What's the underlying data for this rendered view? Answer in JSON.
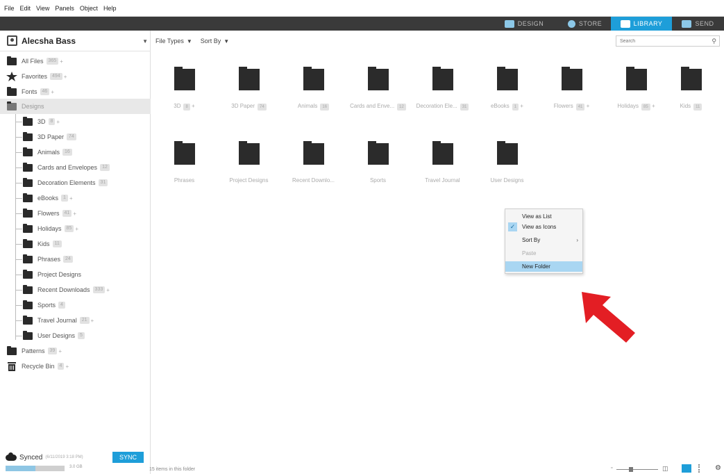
{
  "menu": [
    "File",
    "Edit",
    "View",
    "Panels",
    "Object",
    "Help"
  ],
  "tabs": [
    {
      "label": "DESIGN",
      "icon": "design-icon",
      "active": false
    },
    {
      "label": "STORE",
      "icon": "store-icon",
      "active": false
    },
    {
      "label": "LIBRARY",
      "icon": "library-icon",
      "active": true
    },
    {
      "label": "SEND",
      "icon": "send-icon",
      "active": false
    }
  ],
  "user": {
    "name": "Alecsha Bass"
  },
  "sidebar": {
    "top": [
      {
        "label": "All Files",
        "count": "365",
        "icon": "folder-icon"
      },
      {
        "label": "Favorites",
        "count": "494",
        "icon": "star-icon"
      },
      {
        "label": "Fonts",
        "count": "46",
        "icon": "folder-icon"
      },
      {
        "label": "Designs",
        "count": "",
        "icon": "folder-icon"
      }
    ],
    "designs": [
      {
        "label": "3D",
        "count": "8"
      },
      {
        "label": "3D Paper",
        "count": "74"
      },
      {
        "label": "Animals",
        "count": "16"
      },
      {
        "label": "Cards and Envelopes",
        "count": "12"
      },
      {
        "label": "Decoration Elements",
        "count": "31"
      },
      {
        "label": "eBooks",
        "count": "1"
      },
      {
        "label": "Flowers",
        "count": "41"
      },
      {
        "label": "Holidays",
        "count": "85"
      },
      {
        "label": "Kids",
        "count": "11"
      },
      {
        "label": "Phrases",
        "count": "24"
      },
      {
        "label": "Project Designs",
        "count": ""
      },
      {
        "label": "Recent Downloads",
        "count": "333"
      },
      {
        "label": "Sports",
        "count": "4"
      },
      {
        "label": "Travel Journal",
        "count": "21"
      },
      {
        "label": "User Designs",
        "count": "5"
      }
    ],
    "bottom": [
      {
        "label": "Patterns",
        "count": "39"
      },
      {
        "label": "Recycle Bin",
        "count": "4"
      }
    ],
    "sync": {
      "label": "Synced",
      "date": "(6/11/2019 3:18 PM)",
      "button": "SYNC",
      "storage": "3.0 GB",
      "storage_used": 0.5
    }
  },
  "toolbar": {
    "file_types": "File Types",
    "sort_by": "Sort By",
    "search_placeholder": "Search"
  },
  "folders": [
    {
      "label": "3D",
      "count": "8"
    },
    {
      "label": "3D Paper",
      "count": "74"
    },
    {
      "label": "Animals",
      "count": "16"
    },
    {
      "label": "Cards and Enve...",
      "count": "12"
    },
    {
      "label": "Decoration Ele...",
      "count": "31"
    },
    {
      "label": "eBooks",
      "count": "1"
    },
    {
      "label": "Flowers",
      "count": "41"
    },
    {
      "label": "Holidays",
      "count": "85"
    },
    {
      "label": "Kids",
      "count": "11"
    },
    {
      "label": "Phrases",
      "count": ""
    },
    {
      "label": "Project Designs",
      "count": ""
    },
    {
      "label": "Recent Downlo...",
      "count": ""
    },
    {
      "label": "Sports",
      "count": ""
    },
    {
      "label": "Travel Journal",
      "count": ""
    },
    {
      "label": "User Designs",
      "count": ""
    }
  ],
  "context_menu": {
    "items": [
      {
        "label": "View as List"
      },
      {
        "label": "View as Icons"
      },
      {
        "label": "Sort By"
      },
      {
        "label": "Paste"
      },
      {
        "label": "New Folder"
      }
    ]
  },
  "status": {
    "text": "15 items in this folder"
  },
  "colors": {
    "accent": "#1e9ed9",
    "arrow": "#e31e24"
  }
}
